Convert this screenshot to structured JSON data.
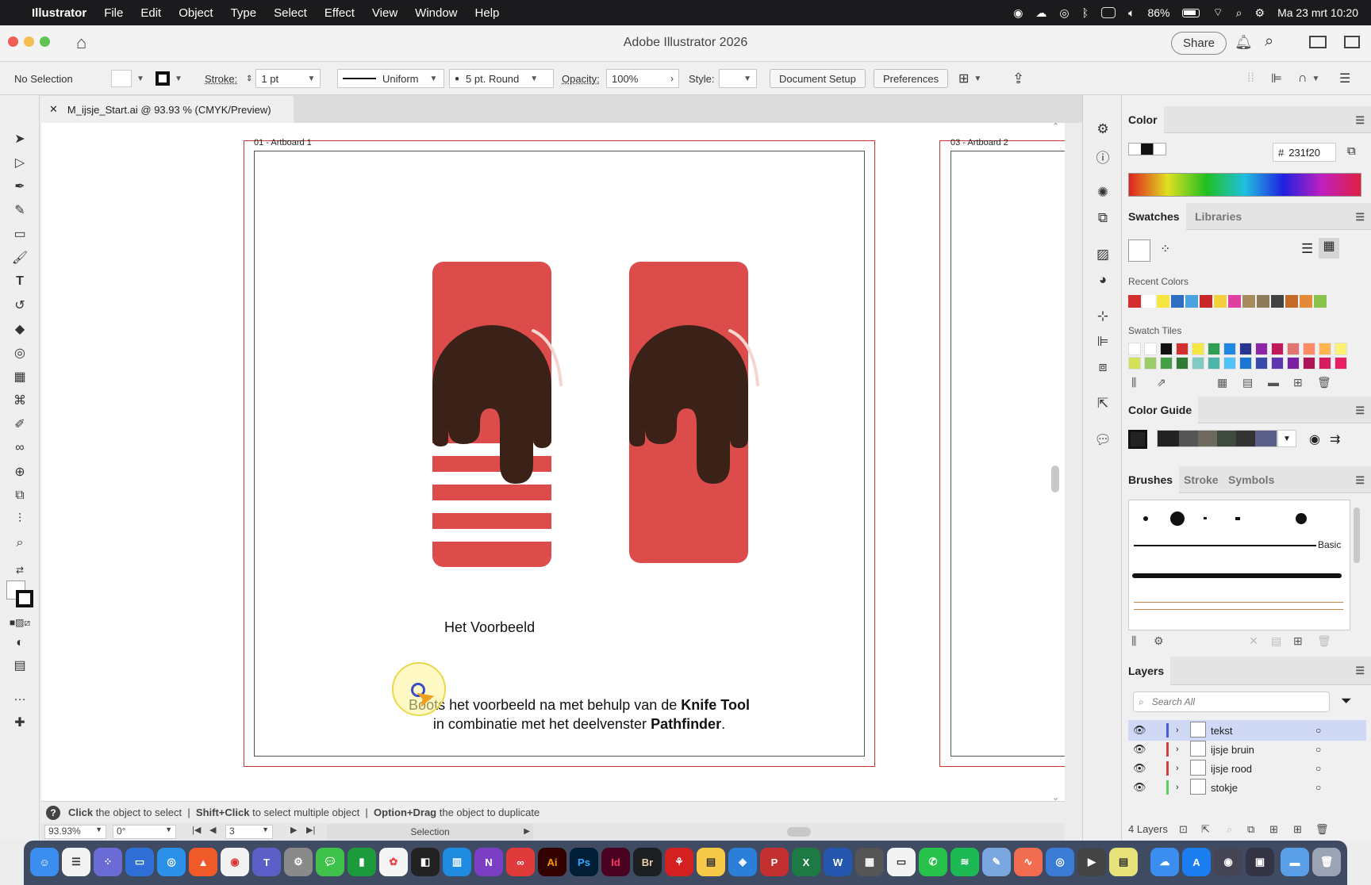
{
  "menubar": {
    "app": "Illustrator",
    "items": [
      "File",
      "Edit",
      "Object",
      "Type",
      "Select",
      "Effect",
      "View",
      "Window",
      "Help"
    ],
    "battery": "86%",
    "datetime": "Ma 23 mrt  10:20"
  },
  "window": {
    "title": "Adobe Illustrator 2026",
    "share": "Share"
  },
  "controlbar": {
    "selection": "No Selection",
    "stroke_label": "Stroke:",
    "stroke_value": "1 pt",
    "profile": "Uniform",
    "brush": "5 pt. Round",
    "opacity_label": "Opacity:",
    "opacity_value": "100%",
    "style_label": "Style:",
    "document_setup": "Document Setup",
    "preferences": "Preferences"
  },
  "document_tab": {
    "title": "M_ijsje_Start.ai @ 93.93 % (CMYK/Preview)"
  },
  "canvas": {
    "artboard1_label": "01 - Artboard 1",
    "artboard2_label": "03 - Artboard 2",
    "caption": "Het Voorbeeld",
    "instruction_part1": "Boots het voorbeeld na met behulp van de ",
    "instruction_bold1": "Knife Tool",
    "instruction_part2": "in combinatie met het deelvenster ",
    "instruction_bold2": "Pathfinder",
    "instruction_end": ".",
    "colors": {
      "chocolate": "#3a2218",
      "red": "#dc4c4b",
      "stick": "#b8946a"
    }
  },
  "statusbar": {
    "click": "Click",
    "click_text": " the object to select  |  ",
    "shift": "Shift+Click",
    "shift_text": " to select multiple object  |  ",
    "option": "Option+Drag",
    "option_text": " the object to duplicate",
    "zoom": "93.93%",
    "rotation": "0°",
    "artboard_num": "3",
    "tool": "Selection"
  },
  "color_panel": {
    "title": "Color",
    "hex_label": "#",
    "hex": "231f20"
  },
  "swatches_panel": {
    "tabs": [
      "Swatches",
      "Libraries"
    ],
    "recent_label": "Recent Colors",
    "tiles_label": "Swatch Tiles",
    "recent": [
      "#d32f2f",
      "#ffffff",
      "#f5e642",
      "#2f6fc0",
      "#4aa3df",
      "#c62828",
      "#f3d03e",
      "#e040a0",
      "#a88b5c",
      "#8c7b5a",
      "#424242",
      "#c46a2a",
      "#e28a3a",
      "#8bc34a"
    ]
  },
  "color_guide": {
    "title": "Color Guide"
  },
  "brushes_panel": {
    "tabs": [
      "Brushes",
      "Stroke",
      "Symbols"
    ],
    "basic": "Basic"
  },
  "layers_panel": {
    "title": "Layers",
    "search_placeholder": "Search All",
    "count": "4 Layers",
    "layers": [
      {
        "name": "tekst",
        "color": "#4a5bd6",
        "selected": true
      },
      {
        "name": "ijsje bruin",
        "color": "#d04040",
        "selected": false
      },
      {
        "name": "ijsje rood",
        "color": "#d04040",
        "selected": false
      },
      {
        "name": "stokje",
        "color": "#5ccf5c",
        "selected": false
      }
    ]
  },
  "dock": {
    "apps": [
      "Ai",
      "Ps",
      "Id",
      "Br"
    ]
  }
}
